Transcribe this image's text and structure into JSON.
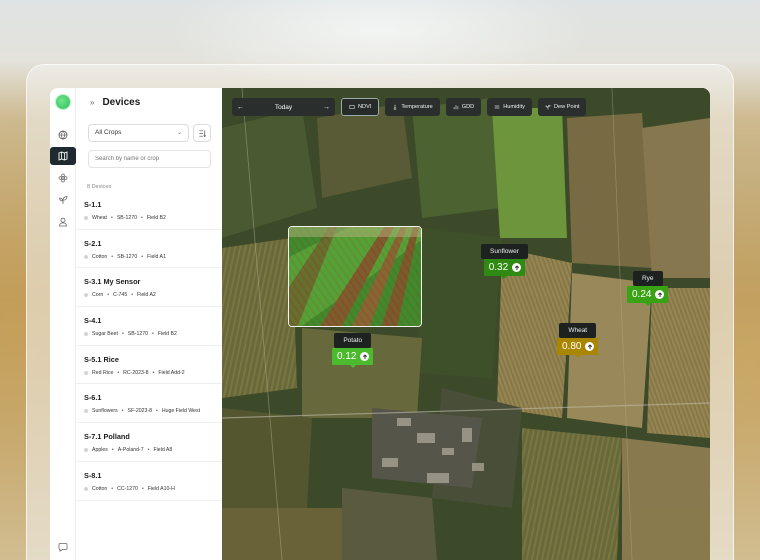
{
  "sidebar": {
    "title": "Devices",
    "collapse_icon": "»",
    "crop_filter": "All Crops",
    "search_placeholder": "Search by name or crop",
    "device_count": "8 Devices",
    "devices": [
      {
        "name": "S-1.1",
        "crop": "Wheat",
        "sensor": "SB-1270",
        "field": "Field B2"
      },
      {
        "name": "S-2.1",
        "crop": "Cotton",
        "sensor": "SB-1270",
        "field": "Field A1"
      },
      {
        "name": "S-3.1 My Sensor",
        "crop": "Corn",
        "sensor": "C-745",
        "field": "Field A2"
      },
      {
        "name": "S-4.1",
        "crop": "Sugar Beet",
        "sensor": "SB-1270",
        "field": "Field B2"
      },
      {
        "name": "S-5.1 Rice",
        "crop": "Red Rice",
        "sensor": "RC-2023-8",
        "field": "Field Add-2"
      },
      {
        "name": "S-6.1",
        "crop": "Sunflowers",
        "sensor": "SF-2023-8",
        "field": "Huge Field West"
      },
      {
        "name": "S-7.1 Polland",
        "crop": "Apples",
        "sensor": "A-Poland-7",
        "field": "Field A8"
      },
      {
        "name": "S-8.1",
        "crop": "Cotton",
        "sensor": "CC-1270",
        "field": "Field A10-H"
      }
    ]
  },
  "rail": {
    "icons": [
      "globe-icon",
      "map-icon",
      "flower-icon",
      "sprout-icon",
      "user-icon",
      "chat-icon"
    ]
  },
  "map": {
    "date_label": "Today",
    "layers": [
      "NDVI",
      "Temperature",
      "GDD",
      "Humidity",
      "Dew Point"
    ],
    "active_layer": "NDVI",
    "markers": [
      {
        "crop": "Potato",
        "value": "0.12",
        "color": "#4cba2e"
      },
      {
        "crop": "Sunflower",
        "value": "0.32",
        "color": "#2f8a12"
      },
      {
        "crop": "Rye",
        "value": "0.24",
        "color": "#3aa315"
      },
      {
        "crop": "Wheat",
        "value": "0.80",
        "color": "#a88600"
      }
    ]
  },
  "colors": {
    "rail_active": "#1f2a30",
    "logo": "#2fbf5a",
    "toolbar_bg": "#2a2e2c"
  }
}
